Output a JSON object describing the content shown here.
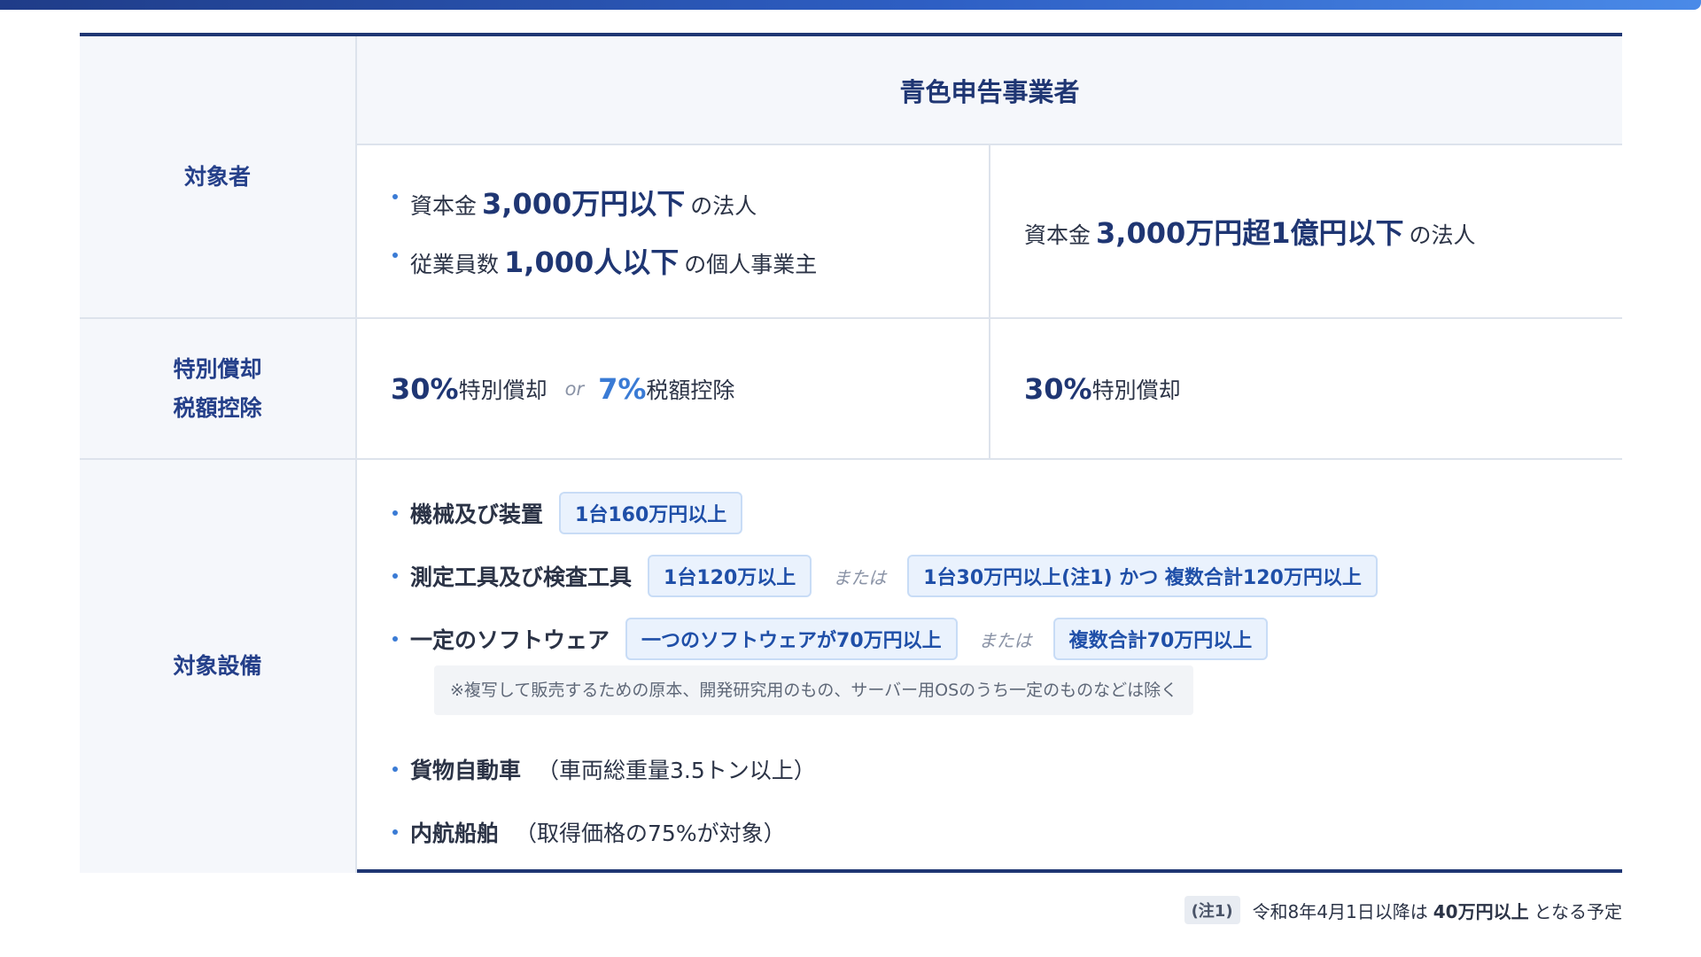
{
  "header": {
    "title": "青色申告事業者"
  },
  "labels": {
    "target": "対象者",
    "deduction_line1": "特別償却",
    "deduction_line2": "税額控除",
    "equipment": "対象設備"
  },
  "target": {
    "left": [
      {
        "pre": "資本金",
        "value": "3,000万円以下",
        "post": "の法人"
      },
      {
        "pre": "従業員数",
        "value": "1,000人以下",
        "post": "の個人事業主"
      }
    ],
    "right": {
      "pre": "資本金",
      "value": "3,000万円超1億円以下",
      "post": "の法人"
    }
  },
  "deduction": {
    "left": {
      "rate1": "30%",
      "text1": "特別償却",
      "or": "or",
      "rate2": "7%",
      "text2": "税額控除"
    },
    "right": {
      "rate": "30%",
      "text": "特別償却"
    }
  },
  "equipment": [
    {
      "name": "機械及び装置",
      "tag1": "1台160万円以上"
    },
    {
      "name": "測定工具及び検査工具",
      "tag1": "1台120万以上",
      "or": "または",
      "tag2": "1台30万円以上(注1) かつ 複数合計120万円以上"
    },
    {
      "name": "一定のソフトウェア",
      "tag1": "一つのソフトウェアが70万円以上",
      "or": "または",
      "tag2": "複数合計70万円以上"
    },
    {
      "name": "貨物自動車",
      "extra": "（車両総重量3.5トン以上）"
    },
    {
      "name": "内航船舶",
      "extra": "（取得価格の75%が対象）"
    }
  ],
  "software_note": "※複写して販売するための原本、開発研究用のもの、サーバー用OSのうち一定のものなどは除く",
  "footnote": {
    "tag": "(注1)",
    "pre": "令和8年4月1日以降は",
    "bold": "40万円以上",
    "post": "となる予定"
  },
  "colors": {
    "navy": "#1f3673",
    "accent_blue": "#3a7bd5",
    "tag_bg": "#eaf2fd"
  }
}
